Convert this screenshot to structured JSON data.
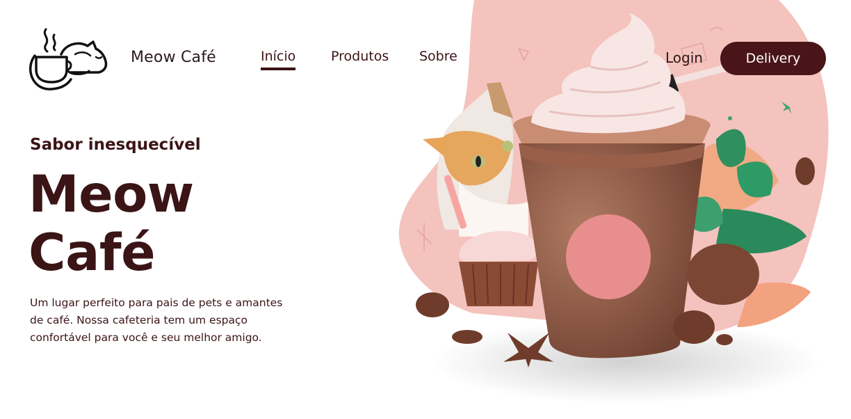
{
  "brand": {
    "name": "Meow Café"
  },
  "nav": {
    "items": [
      {
        "label": "Início",
        "active": true
      },
      {
        "label": "Produtos",
        "active": false
      },
      {
        "label": "Sobre",
        "active": false
      }
    ],
    "login": "Login",
    "delivery": "Delivery"
  },
  "hero": {
    "tagline": "Sabor inesquecível",
    "title_line1": "Meow",
    "title_line2": "Café",
    "description": "Um lugar perfeito para pais de pets e amantes de café. Nossa cafeteria tem um espaço confortável para você e seu melhor amigo."
  },
  "colors": {
    "primary": "#3b1416",
    "button": "#4a1519",
    "pink_blob": "#f4c3bd",
    "cup": "#8a5a45",
    "cup_dot": "#e88e8e",
    "cream": "#f7e6e4"
  },
  "icons": {
    "logo": "cat-coffee-cup-icon"
  }
}
